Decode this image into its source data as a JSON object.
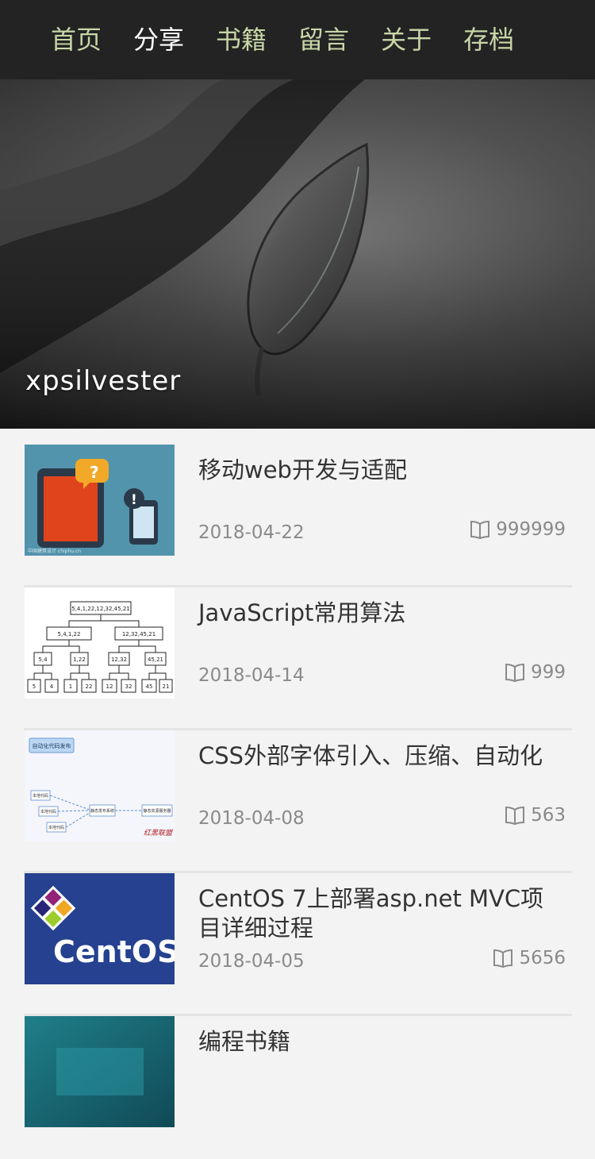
{
  "nav": {
    "items": [
      {
        "label": "首页",
        "active": false
      },
      {
        "label": "分享",
        "active": true
      },
      {
        "label": "书籍",
        "active": false
      },
      {
        "label": "留言",
        "active": false
      },
      {
        "label": "关于",
        "active": false
      },
      {
        "label": "存档",
        "active": false
      }
    ],
    "colors": {
      "background": "#232323",
      "item": "#c8d6a7",
      "active": "#ffffff"
    }
  },
  "hero": {
    "title": "xpsilvester",
    "image": "dark-leaf-wallpaper"
  },
  "posts": [
    {
      "title": "移动web开发与适配",
      "date": "2018-04-22",
      "views": "999999",
      "thumb": "mobile-devices-illustration",
      "thumb_credit": "中国建筑设计 chiphu.cn"
    },
    {
      "title": "JavaScript常用算法",
      "date": "2018-04-14",
      "views": "999",
      "thumb": "merge-sort-tree-diagram",
      "tree": {
        "root": "5,4,1,22,12,32,45,21",
        "level1": [
          "5,4,1,22",
          "12,32,45,21"
        ],
        "level2": [
          "5,4",
          "1,22",
          "12,32",
          "45,21"
        ],
        "leaves": [
          "5",
          "4",
          "1",
          "22",
          "12",
          "32",
          "45",
          "21"
        ]
      }
    },
    {
      "title": "CSS外部字体引入、压缩、自动化",
      "date": "2018-04-08",
      "views": "563",
      "thumb": "automation-flow-diagram",
      "flow": {
        "header": "自动化代码发布",
        "sources": [
          "本地代码",
          "本地代码",
          "本地代码"
        ],
        "center": "静态发布系统",
        "target": "静态资源服务器",
        "stamp": "红黑联盟"
      }
    },
    {
      "title": "CentOS 7上部署asp.net MVC项目详细过程",
      "date": "2018-04-05",
      "views": "5656",
      "thumb": "centos-logo",
      "logo_text": "CentOS"
    },
    {
      "title": "编程书籍",
      "date": "",
      "views": "",
      "thumb": "teal-photo"
    }
  ],
  "icons": {
    "views": "open-book-icon"
  }
}
